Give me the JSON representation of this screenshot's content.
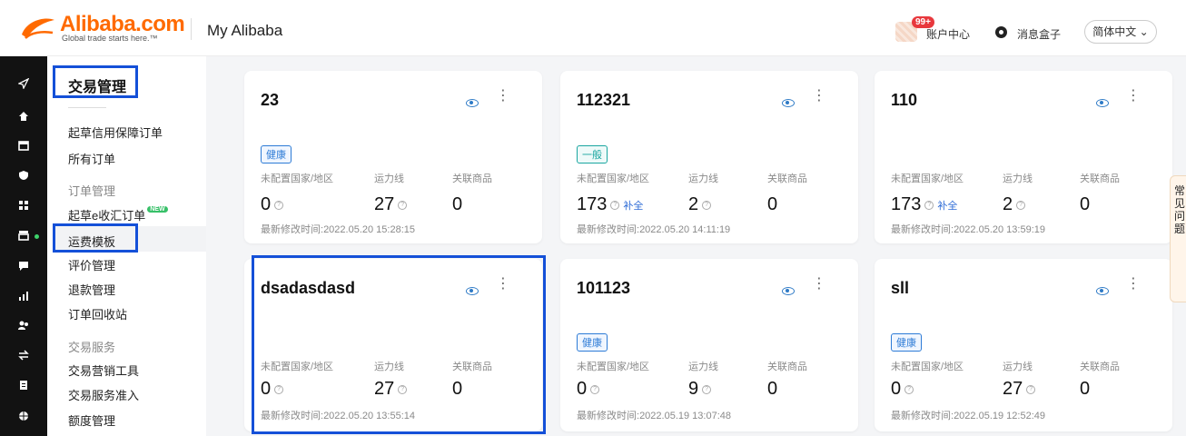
{
  "header": {
    "logo_text": "Alibaba.com",
    "logo_slogan": "Global trade starts here.™",
    "page_title": "My Alibaba",
    "notification_count": "99+",
    "account_center": "账户中心",
    "message_box": "消息盒子",
    "language": "简体中文 ⌄"
  },
  "sidebar": {
    "title": "交易管理",
    "items": [
      {
        "label": "起草信用保障订单",
        "type": "link"
      },
      {
        "label": "所有订单",
        "type": "link"
      },
      {
        "label": "订单管理",
        "type": "group"
      },
      {
        "label": "起草e收汇订单",
        "type": "link",
        "badge": "NEW"
      },
      {
        "label": "运费模板",
        "type": "link",
        "active": true
      },
      {
        "label": "评价管理",
        "type": "link"
      },
      {
        "label": "退款管理",
        "type": "link"
      },
      {
        "label": "订单回收站",
        "type": "link"
      },
      {
        "label": "交易服务",
        "type": "group"
      },
      {
        "label": "交易营销工具",
        "type": "link"
      },
      {
        "label": "交易服务准入",
        "type": "link"
      },
      {
        "label": "额度管理",
        "type": "link"
      }
    ]
  },
  "rail_icons": [
    "send-icon",
    "home-icon",
    "store-icon",
    "shield-icon",
    "grid-icon",
    "storefront-icon",
    "chat-icon",
    "chart-icon",
    "people-icon",
    "exchange-icon",
    "clipboard-icon",
    "globe-icon"
  ],
  "card_labels": {
    "unconfigured": "未配置国家/地区",
    "lines": "运力线",
    "products": "关联商品",
    "modified_prefix": "最新修改时间:",
    "fix": "补全"
  },
  "cards": [
    {
      "name": "23",
      "tag": "健康",
      "unconfigured": "0",
      "lines": "27",
      "products": "0",
      "modified": "2022.05.20 15:28:15"
    },
    {
      "name": "112321",
      "tag": "一般",
      "unconfigured": "173",
      "lines": "2",
      "products": "0",
      "modified": "2022.05.20 14:11:19"
    },
    {
      "name": "110",
      "tag": "",
      "unconfigured": "173",
      "lines": "2",
      "products": "0",
      "modified": "2022.05.20 13:59:19"
    },
    {
      "name": "dsadasdasd",
      "tag": "",
      "unconfigured": "0",
      "lines": "27",
      "products": "0",
      "modified": "2022.05.20 13:55:14"
    },
    {
      "name": "101123",
      "tag": "健康",
      "unconfigured": "0",
      "lines": "9",
      "products": "0",
      "modified": "2022.05.19 13:07:48"
    },
    {
      "name": "sll",
      "tag": "健康",
      "unconfigured": "0",
      "lines": "27",
      "products": "0",
      "modified": "2022.05.19 12:52:49"
    }
  ],
  "float_help": [
    "常",
    "见",
    "问",
    "题"
  ],
  "colors": {
    "brand": "#ff6a00",
    "highlight": "#1450d8",
    "link": "#2d6bd6",
    "tag_health": "#2d7bd6",
    "tag_general": "#1aa6a0"
  }
}
